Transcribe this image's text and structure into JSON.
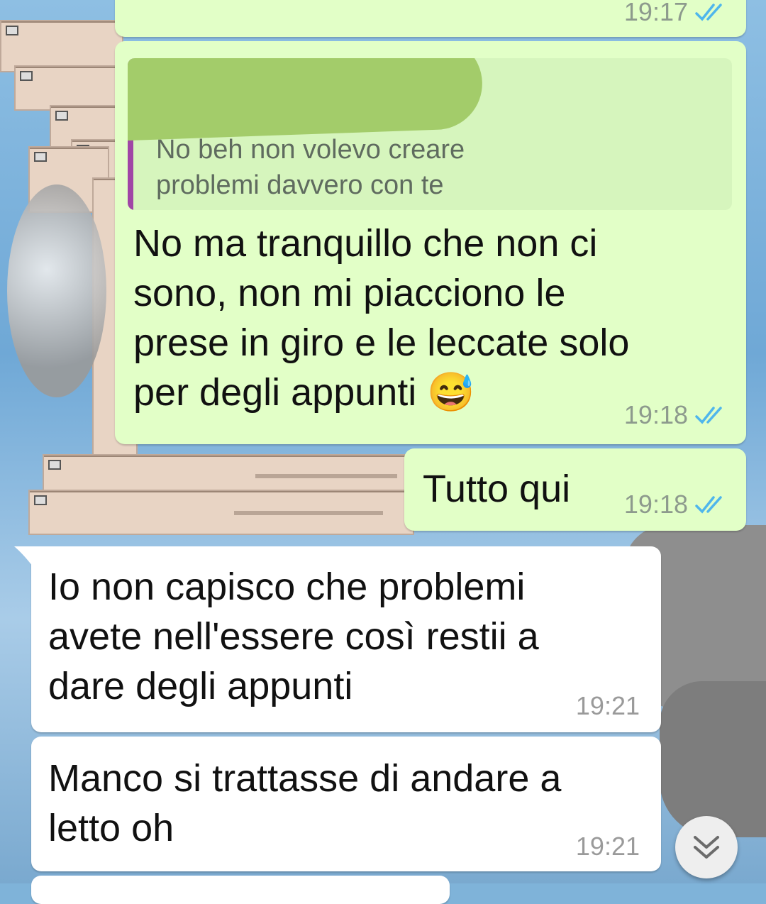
{
  "messages": [
    {
      "time": "19:17"
    },
    {
      "quote": {
        "text_line1": "No beh non volevo creare",
        "text_line2": "problemi davvero con te"
      },
      "lines": [
        "No ma tranquillo che non ci",
        "sono, non mi piacciono le",
        "prese in giro e le leccate solo",
        "per degli appunti 😅"
      ],
      "time": "19:18"
    },
    {
      "lines": [
        "Tutto qui"
      ],
      "time": "19:18"
    },
    {
      "lines": [
        "Io non capisco che problemi",
        "avete nell'essere così restii a",
        "dare degli appunti"
      ],
      "time": "19:21"
    },
    {
      "lines": [
        "Manco si trattasse di andare a",
        "letto oh"
      ],
      "time": "19:21"
    }
  ],
  "icons": {
    "read_receipt": "double-check-icon",
    "scroll_down": "chevron-double-down-icon"
  },
  "colors": {
    "outgoing_bubble": "#e2ffc7",
    "incoming_bubble": "#ffffff",
    "read_tick": "#4fb6ec",
    "quote_bar": "#a046a6"
  }
}
